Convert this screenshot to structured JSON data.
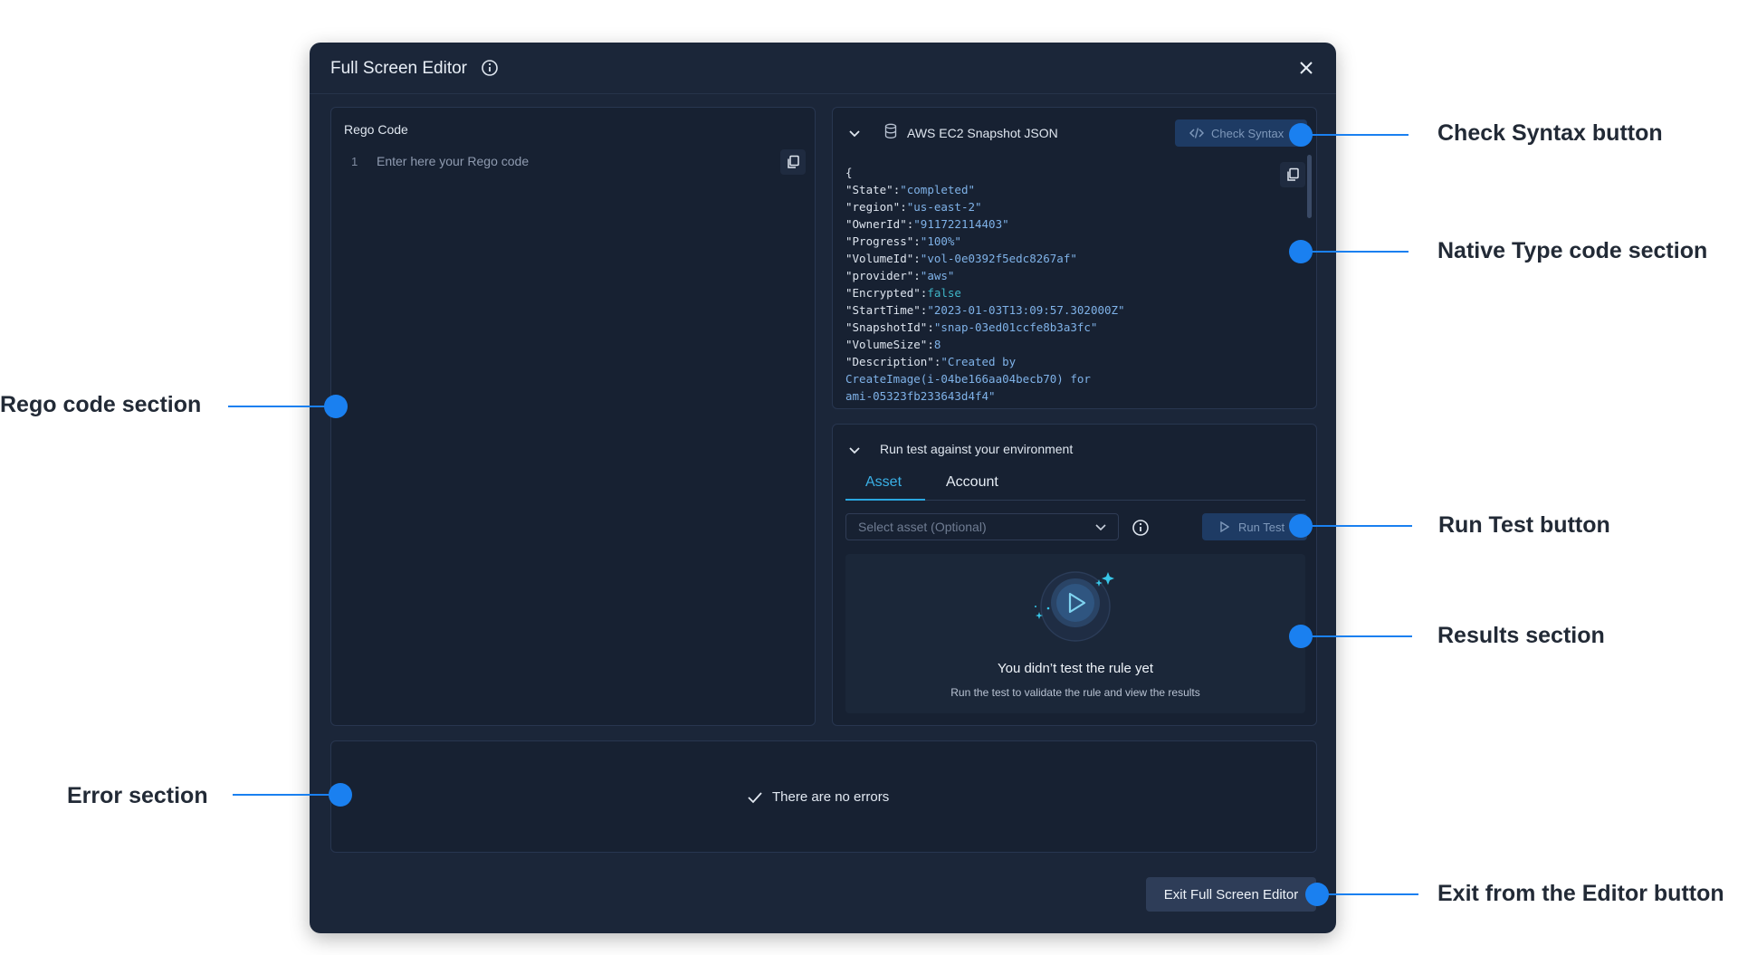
{
  "modal": {
    "title": "Full Screen Editor",
    "exit_label": "Exit Full Screen Editor"
  },
  "rego": {
    "title": "Rego Code",
    "line_number": "1",
    "placeholder": "Enter here your Rego code"
  },
  "json_panel": {
    "title": "AWS EC2 Snapshot JSON",
    "check_syntax_label": "Check Syntax",
    "open_brace": "{",
    "lines": [
      {
        "key": "\"State\"",
        "sep": ":",
        "value": "\"completed\"",
        "kind": "str"
      },
      {
        "key": "\"region\"",
        "sep": ":",
        "value": "\"us-east-2\"",
        "kind": "str"
      },
      {
        "key": "\"OwnerId\"",
        "sep": ":",
        "value": "\"911722114403\"",
        "kind": "str"
      },
      {
        "key": "\"Progress\"",
        "sep": ":",
        "value": "\"100%\"",
        "kind": "str"
      },
      {
        "key": "\"VolumeId\"",
        "sep": ":",
        "value": "\"vol-0e0392f5edc8267af\"",
        "kind": "str"
      },
      {
        "key": "\"provider\"",
        "sep": ":",
        "value": "\"aws\"",
        "kind": "str"
      },
      {
        "key": "\"Encrypted\"",
        "sep": ":",
        "value": "false",
        "kind": "bool"
      },
      {
        "key": "\"StartTime\"",
        "sep": ":",
        "value": "\"2023-01-03T13:09:57.302000Z\"",
        "kind": "str"
      },
      {
        "key": "\"SnapshotId\"",
        "sep": ":",
        "value": "\"snap-03ed01ccfe8b3a3fc\"",
        "kind": "str"
      },
      {
        "key": "\"VolumeSize\"",
        "sep": ":",
        "value": "8",
        "kind": "str"
      },
      {
        "key": "\"Description\"",
        "sep": ":",
        "value": "\"Created by",
        "kind": "str"
      },
      {
        "key": "",
        "sep": "",
        "value": "CreateImage(i-04be166aa04becb70) for",
        "kind": "str"
      },
      {
        "key": "",
        "sep": "",
        "value": "ami-05323fb233643d4f4\"",
        "kind": "str"
      }
    ]
  },
  "test_panel": {
    "title": "Run test against your environment",
    "tabs": [
      {
        "label": "Asset",
        "active": true
      },
      {
        "label": "Account",
        "active": false
      }
    ],
    "select_placeholder": "Select asset (Optional)",
    "run_label": "Run Test",
    "result_title": "You didn’t test the rule yet",
    "result_subtitle": "Run the test to validate the rule and view the results"
  },
  "error_panel": {
    "message": "There are no errors"
  },
  "callouts": {
    "check_syntax": "Check Syntax button",
    "native_type": "Native Type code section",
    "rego_code": "Rego code section",
    "run_test": "Run Test button",
    "results": "Results section",
    "error": "Error section",
    "exit": "Exit from the Editor button"
  },
  "colors": {
    "accent": "#1a80f0",
    "modal_bg": "#1b2639",
    "panel_bg": "#172132",
    "tab_active": "#3ab0e6",
    "json_value": "#7fb2e8"
  }
}
